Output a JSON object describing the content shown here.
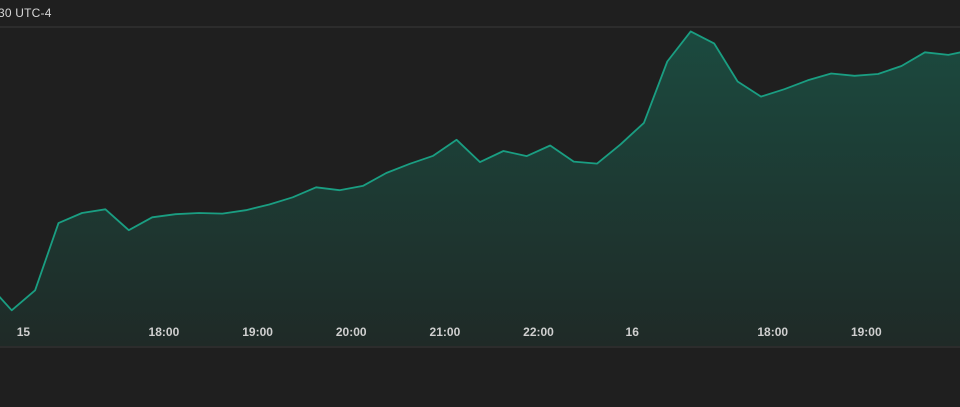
{
  "header": {
    "timestamp": "30 UTC-4"
  },
  "colors": {
    "background": "#1f1f1f",
    "line": "#1a9e82",
    "area_top": "#1b4a3f",
    "area_bottom": "#1f2a27",
    "grid": "#3a3a3a"
  },
  "chart_data": {
    "type": "area",
    "title": "",
    "xlabel": "",
    "ylabel": "",
    "grid": false,
    "x_ticks": [
      {
        "label": "15",
        "at": 1.5
      },
      {
        "label": "18:00",
        "at": 7.5
      },
      {
        "label": "19:00",
        "at": 11.5
      },
      {
        "label": "20:00",
        "at": 15.5
      },
      {
        "label": "21:00",
        "at": 19.5
      },
      {
        "label": "22:00",
        "at": 23.5
      },
      {
        "label": "16",
        "at": 27.5
      },
      {
        "label": "18:00",
        "at": 33.5
      },
      {
        "label": "19:00",
        "at": 37.5
      }
    ],
    "x_range": [
      -0.5,
      40.5
    ],
    "ylim": [
      0,
      100
    ],
    "values": [
      11,
      2,
      9,
      32.5,
      36,
      37.3,
      30,
      34.5,
      35.6,
      36,
      35.8,
      37,
      39,
      41.5,
      45,
      44,
      45.5,
      50,
      53.2,
      56,
      61.6,
      53.8,
      57.7,
      55.9,
      59.6,
      54,
      53.3,
      60,
      67.5,
      89,
      99.5,
      95.3,
      82,
      76.7,
      79.3,
      82.4,
      84.8,
      84,
      84.6,
      87.4,
      92.2,
      91.3,
      93
    ]
  }
}
